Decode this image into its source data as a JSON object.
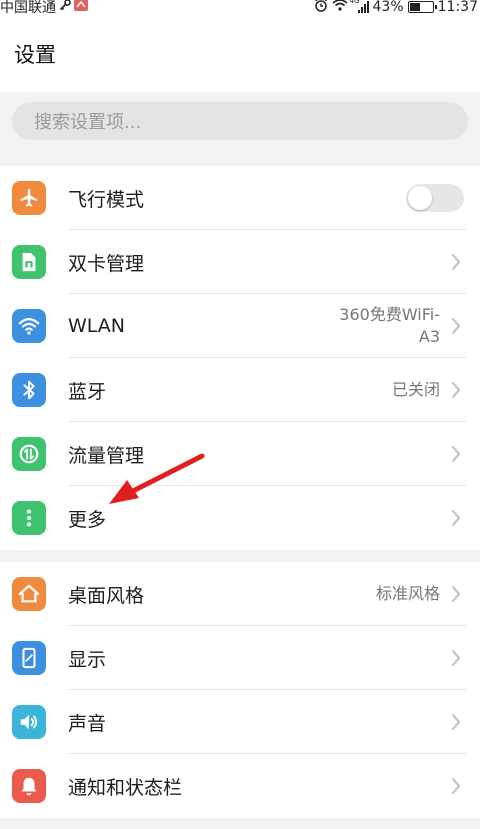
{
  "status_bar": {
    "carrier": "中国联通",
    "battery": "43%",
    "battery_level": 0.43,
    "time": "11:37",
    "signal_badge": "4G"
  },
  "header": {
    "title": "设置"
  },
  "search": {
    "placeholder": "搜索设置项..."
  },
  "groups": [
    {
      "items": [
        {
          "id": "airplane",
          "label": "飞行模式",
          "icon": "airplane-icon",
          "color": "#f08a3c",
          "control": "toggle",
          "toggle_on": false
        },
        {
          "id": "dual-sim",
          "label": "双卡管理",
          "icon": "sim-card-icon",
          "color": "#3fc36f",
          "control": "chevron"
        },
        {
          "id": "wlan",
          "label": "WLAN",
          "icon": "wifi-icon",
          "color": "#3d8fe0",
          "value_line1": "360免费WiFi-",
          "value_line2": "A3",
          "control": "chevron"
        },
        {
          "id": "bluetooth",
          "label": "蓝牙",
          "icon": "bluetooth-icon",
          "color": "#3d8fe0",
          "value": "已关闭",
          "control": "chevron"
        },
        {
          "id": "data-usage",
          "label": "流量管理",
          "icon": "data-usage-icon",
          "color": "#3fc36f",
          "control": "chevron"
        },
        {
          "id": "more",
          "label": "更多",
          "icon": "more-dots-icon",
          "color": "#3fc36f",
          "control": "chevron"
        }
      ]
    },
    {
      "items": [
        {
          "id": "home-style",
          "label": "桌面风格",
          "icon": "home-icon",
          "color": "#f08a3c",
          "value": "标准风格",
          "control": "chevron"
        },
        {
          "id": "display",
          "label": "显示",
          "icon": "display-icon",
          "color": "#3d8fe0",
          "control": "chevron"
        },
        {
          "id": "sound",
          "label": "声音",
          "icon": "speaker-icon",
          "color": "#3ab5d8",
          "control": "chevron"
        },
        {
          "id": "notifications",
          "label": "通知和状态栏",
          "icon": "bell-icon",
          "color": "#ea5b4e",
          "control": "chevron"
        }
      ]
    }
  ],
  "annotation": {
    "arrow_color": "#e02020"
  }
}
